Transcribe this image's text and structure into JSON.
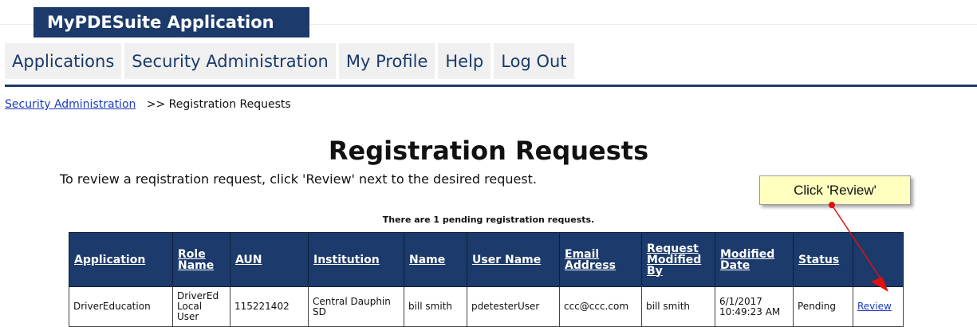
{
  "app": {
    "title": "MyPDESuite Application"
  },
  "nav": {
    "items": [
      "Applications",
      "Security Administration",
      "My Profile",
      "Help",
      "Log Out"
    ]
  },
  "breadcrumb": {
    "link": "Security Administration",
    "separator": ">>",
    "current": "Registration Requests"
  },
  "page": {
    "title": "Registration Requests",
    "instructions": "To review a reqistration request, click 'Review' next to the desired request.",
    "pending_note": "There are 1 pending registration requests."
  },
  "callout": {
    "text": "Click 'Review'"
  },
  "table": {
    "headers": [
      "Application",
      "Role Name",
      "AUN",
      "Institution",
      "Name",
      "User Name",
      "Email Address",
      "Request Modified By",
      "Modified Date",
      "Status",
      ""
    ],
    "rows": [
      {
        "application": "DriverEducation",
        "role_name": "DriverEd Local User",
        "aun": "115221402",
        "institution": "Central Dauphin SD",
        "name": "bill smith",
        "user_name": "pdetesterUser",
        "email": "ccc@ccc.com",
        "modified_by": "bill smith",
        "modified_date": "6/1/2017 10:49:23 AM",
        "status": "Pending",
        "action": "Review"
      }
    ]
  },
  "colors": {
    "brand": "#1c3a6b",
    "link": "#1a3ac0",
    "callout_bg": "#ffffc0",
    "arrow": "#e01010"
  }
}
